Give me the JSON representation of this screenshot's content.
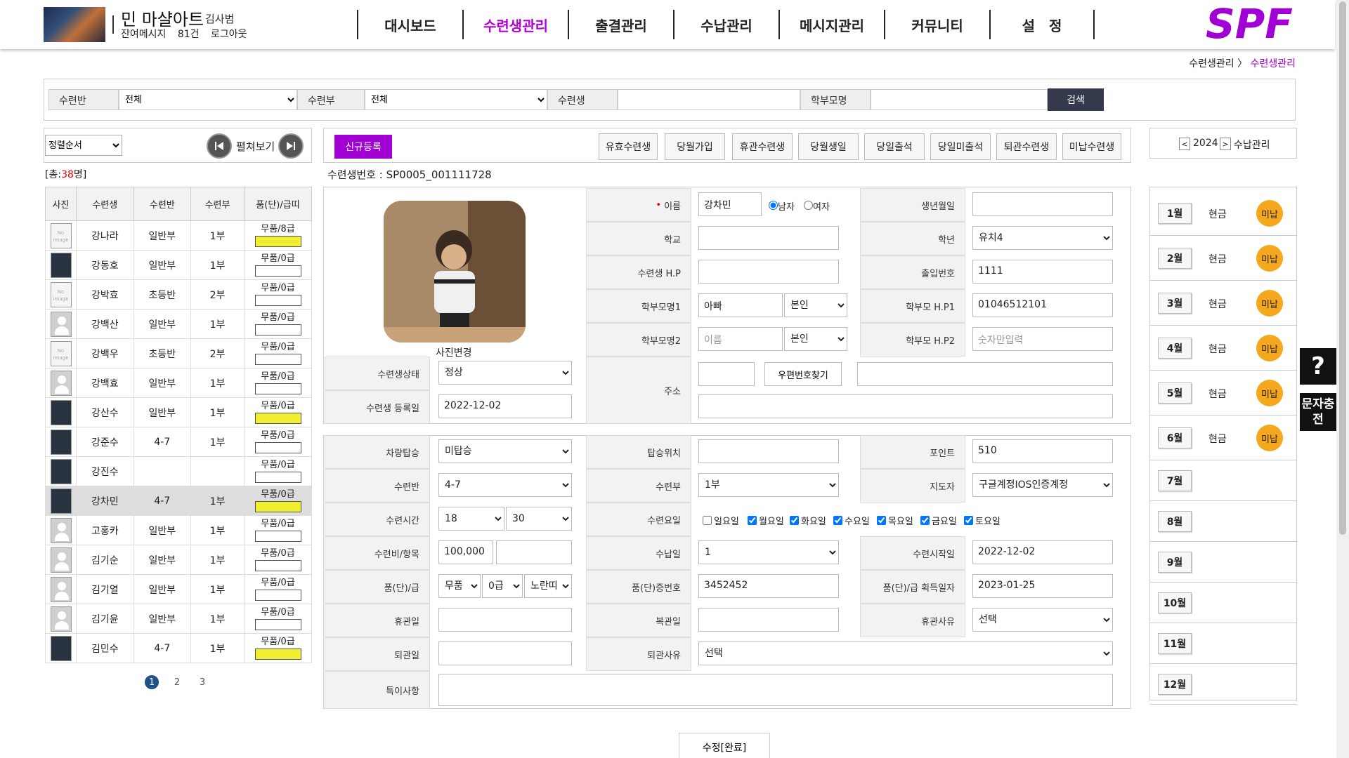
{
  "header": {
    "academy_name": "민 마샬아트",
    "owner": "김사범",
    "msg_label": "잔여메시지",
    "msg_count": "81건",
    "logout": "로그아웃",
    "nav": [
      "대시보드",
      "수련생관리",
      "출결관리",
      "수납관리",
      "메시지관리",
      "커뮤니티",
      "설　정"
    ],
    "brand_logo": "SPF"
  },
  "breadcrumb": {
    "parent": "수련생관리",
    "sep": "〉",
    "current": "수련생관리"
  },
  "search": {
    "class_label": "수련반",
    "class_value": "전체",
    "part_label": "수련부",
    "part_value": "전체",
    "student_label": "수련생",
    "student_value": "",
    "parent_label": "학부모명",
    "parent_value": "",
    "button": "검색"
  },
  "left": {
    "sort_value": "정렬순서",
    "expand_label": "펼쳐보기",
    "total_prefix": "[총:",
    "total_count": "38",
    "total_suffix": "명]",
    "headers": [
      "사진",
      "수련생",
      "수련반",
      "수련부",
      "품(단)/급띠"
    ],
    "noimage_text": "No image",
    "rows": [
      {
        "name": "강나라",
        "cls": "일반부",
        "part": "1부",
        "belt": "무품/8급",
        "yellow": true,
        "photo": "noimg"
      },
      {
        "name": "강동호",
        "cls": "일반부",
        "part": "1부",
        "belt": "무품/0급",
        "yellow": false,
        "photo": "dark"
      },
      {
        "name": "강박효",
        "cls": "초등반",
        "part": "2부",
        "belt": "무품/0급",
        "yellow": false,
        "photo": "noimg"
      },
      {
        "name": "강백산",
        "cls": "일반부",
        "part": "1부",
        "belt": "무품/0급",
        "yellow": false,
        "photo": "avatar"
      },
      {
        "name": "강백우",
        "cls": "초등반",
        "part": "2부",
        "belt": "무품/0급",
        "yellow": false,
        "photo": "noimg"
      },
      {
        "name": "강백효",
        "cls": "일반부",
        "part": "1부",
        "belt": "무품/0급",
        "yellow": false,
        "photo": "avatar"
      },
      {
        "name": "강산수",
        "cls": "일반부",
        "part": "1부",
        "belt": "무품/0급",
        "yellow": true,
        "photo": "dark"
      },
      {
        "name": "강준수",
        "cls": "4-7",
        "part": "1부",
        "belt": "무품/0급",
        "yellow": false,
        "photo": "dark"
      },
      {
        "name": "강진수",
        "cls": "",
        "part": "",
        "belt": "무품/0급",
        "yellow": false,
        "photo": "dark"
      },
      {
        "name": "강차민",
        "cls": "4-7",
        "part": "1부",
        "belt": "무품/0급",
        "yellow": true,
        "photo": "dark",
        "selected": true
      },
      {
        "name": "고홍카",
        "cls": "일반부",
        "part": "1부",
        "belt": "무품/0급",
        "yellow": false,
        "photo": "avatar"
      },
      {
        "name": "김기순",
        "cls": "일반부",
        "part": "1부",
        "belt": "무품/0급",
        "yellow": false,
        "photo": "avatar"
      },
      {
        "name": "김기열",
        "cls": "일반부",
        "part": "1부",
        "belt": "무품/0급",
        "yellow": false,
        "photo": "avatar"
      },
      {
        "name": "김기윤",
        "cls": "일반부",
        "part": "1부",
        "belt": "무품/0급",
        "yellow": false,
        "photo": "avatar"
      },
      {
        "name": "김민수",
        "cls": "4-7",
        "part": "1부",
        "belt": "무품/0급",
        "yellow": true,
        "photo": "dark"
      }
    ],
    "pages": [
      "1",
      "2",
      "3"
    ]
  },
  "toolbar": {
    "new": "신규등록",
    "buttons": [
      "유효수련생",
      "당월가입",
      "휴관수련생",
      "당월생일",
      "당일출석",
      "당일미출석",
      "퇴관수련생",
      "미납수련생"
    ]
  },
  "student_no": "수련생번호 : SP0005_001111728",
  "form": {
    "photo_change": "사진변경",
    "name_label": "이름",
    "required_mark": "•",
    "name_value": "강차민",
    "male": "남자",
    "female": "여자",
    "birth_label": "생년월일",
    "birth_value": "",
    "school_label": "학교",
    "school_value": "",
    "grade_label": "학년",
    "grade_value": "유치4",
    "hp_label": "수련생 H.P",
    "hp_value": "",
    "door_label": "출입번호",
    "door_value": "1111",
    "parent1_label": "학부모명1",
    "parent1_value": "아빠",
    "rel1_value": "본인",
    "php1_label": "학부모 H.P1",
    "php1_value": "01046512101",
    "parent2_label": "학부모명2",
    "parent2_placeholder": "이름",
    "rel2_value": "본인",
    "php2_label": "학부모 H.P2",
    "php2_placeholder": "숫자만입력",
    "status_label": "수련생상태",
    "status_value": "정상",
    "addr_label": "주소",
    "zip_button": "우편번호찾기",
    "regdate_label": "수련생 등록일",
    "regdate_value": "2022-12-02",
    "vehicle_label": "차량탑승",
    "vehicle_value": "미탑승",
    "board_label": "탑승위치",
    "board_value": "",
    "point_label": "포인트",
    "point_value": "510",
    "class_label": "수련반",
    "class_value": "4-7",
    "part_label": "수련부",
    "part_value": "1부",
    "coach_label": "지도자",
    "coach_value": "구글계정IOS인증계정",
    "time_label": "수련시간",
    "hour_value": "18",
    "minute_value": "30",
    "days_label": "수련요일",
    "days": [
      {
        "label": "일요일",
        "checked": false
      },
      {
        "label": "월요일",
        "checked": true
      },
      {
        "label": "화요일",
        "checked": true
      },
      {
        "label": "수요일",
        "checked": true
      },
      {
        "label": "목요일",
        "checked": true
      },
      {
        "label": "금요일",
        "checked": true
      },
      {
        "label": "토요일",
        "checked": true
      }
    ],
    "fee_label": "수련비/항목",
    "fee_value": "100,000",
    "fee_item": "",
    "payday_label": "수납일",
    "payday_value": "1",
    "start_label": "수련시작일",
    "start_value": "2022-12-02",
    "belt_label": "품(단)/급",
    "belt_rank": "무품",
    "belt_grade": "0급",
    "belt_color": "노란띠",
    "cert_label": "품(단)증번호",
    "cert_value": "3452452",
    "acq_label": "품(단)/급 획득일자",
    "acq_value": "2023-01-25",
    "leave_label": "휴관일",
    "leave_value": "",
    "return_label": "복관일",
    "return_value": "",
    "leave_reason_label": "휴관사유",
    "leave_reason_value": "선택",
    "quit_label": "퇴관일",
    "quit_value": "",
    "quit_reason_label": "퇴관사유",
    "quit_reason_value": "선택",
    "notes_label": "특이사항",
    "notes_value": ""
  },
  "payment": {
    "prev": "<",
    "year": "2024",
    "next": ">",
    "title": "수납관리",
    "months": [
      {
        "m": "1월",
        "type": "현금",
        "status": "미납"
      },
      {
        "m": "2월",
        "type": "현금",
        "status": "미납"
      },
      {
        "m": "3월",
        "type": "현금",
        "status": "미납"
      },
      {
        "m": "4월",
        "type": "현금",
        "status": "미납"
      },
      {
        "m": "5월",
        "type": "현금",
        "status": "미납"
      },
      {
        "m": "6월",
        "type": "현금",
        "status": "미납"
      },
      {
        "m": "7월",
        "type": "",
        "status": ""
      },
      {
        "m": "8월",
        "type": "",
        "status": ""
      },
      {
        "m": "9월",
        "type": "",
        "status": ""
      },
      {
        "m": "10월",
        "type": "",
        "status": ""
      },
      {
        "m": "11월",
        "type": "",
        "status": ""
      },
      {
        "m": "12월",
        "type": "",
        "status": ""
      }
    ]
  },
  "side": {
    "help": "?",
    "sms": "문자충전"
  },
  "submit": "수정[완료]",
  "colors": {
    "accent": "#a100d4",
    "unpaid": "#f5a81c",
    "belt_yellow": "#f0ee30",
    "search_btn": "#343a4c"
  }
}
